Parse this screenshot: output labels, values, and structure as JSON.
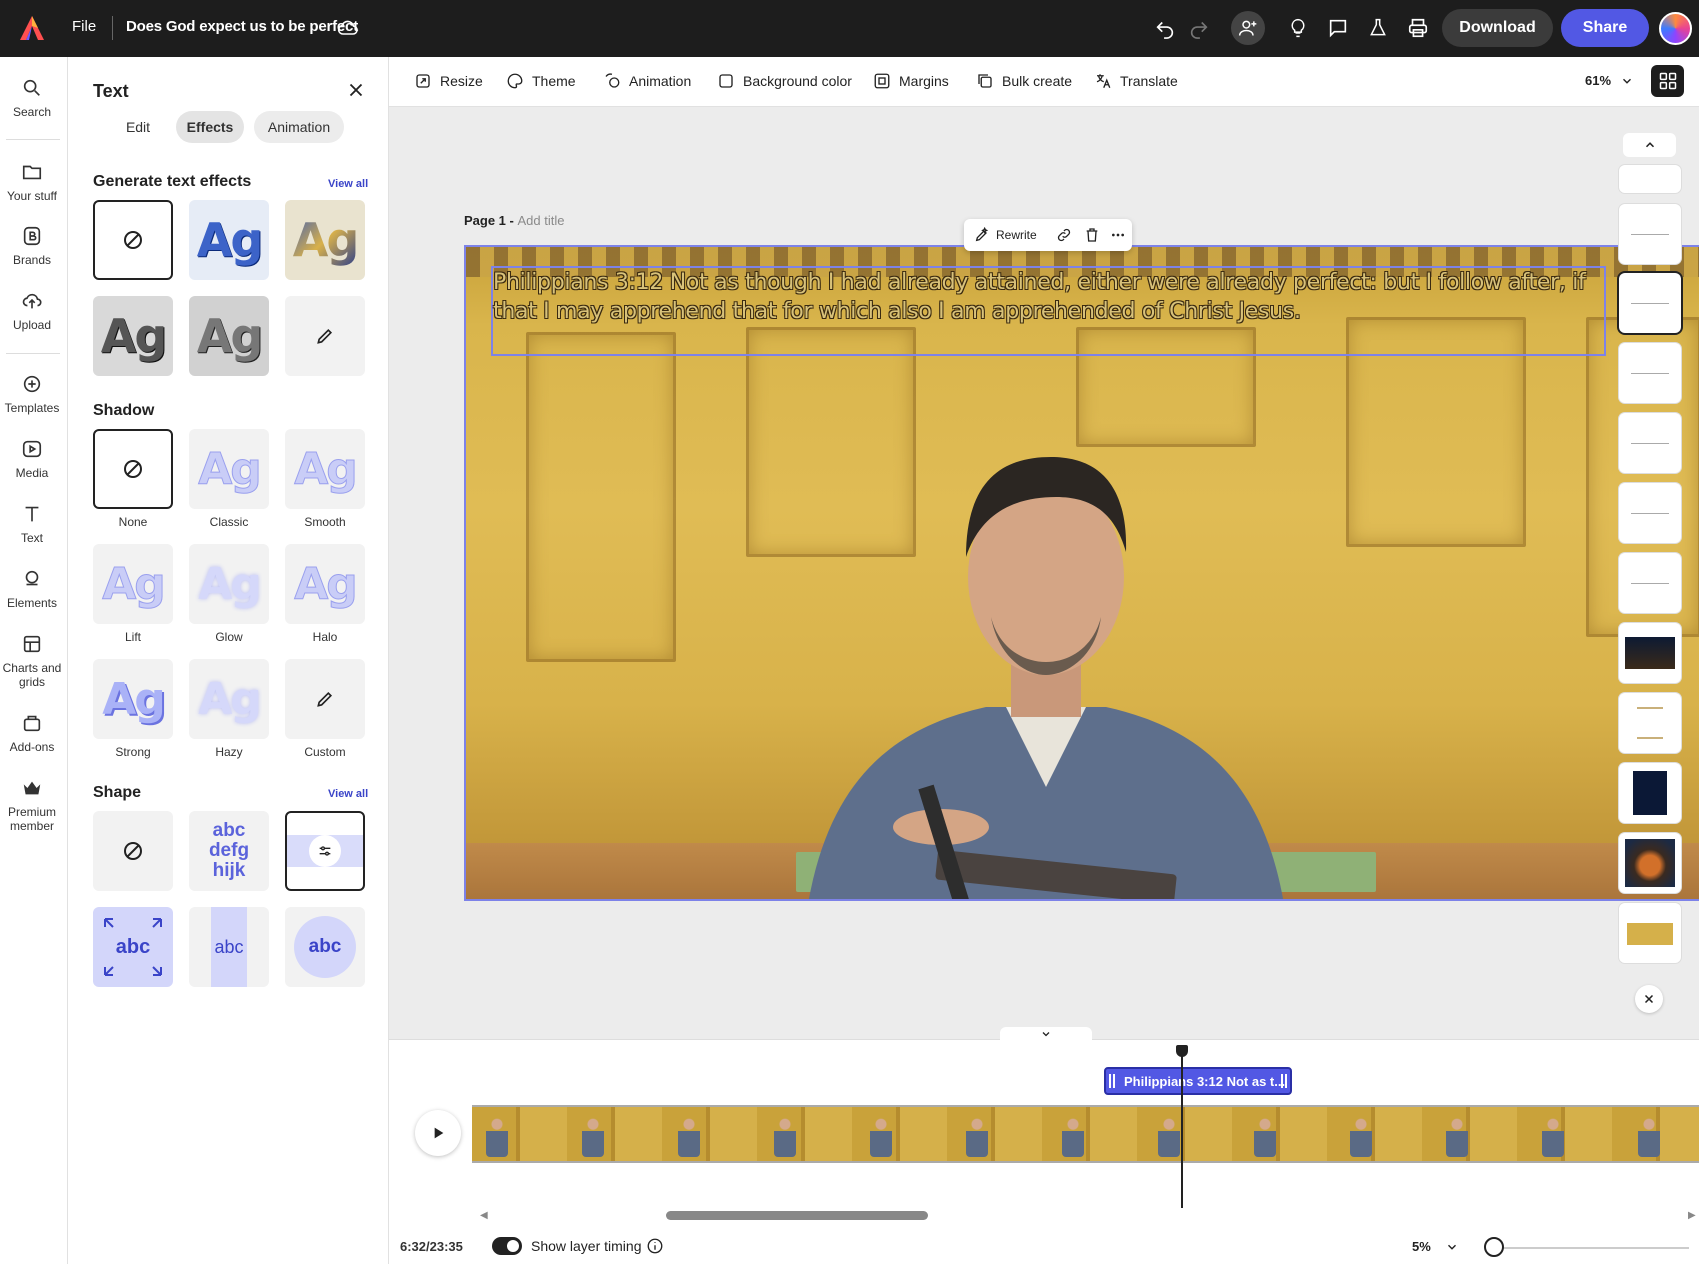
{
  "topbar": {
    "file_label": "File",
    "doc_title": "Does God expect us to be perfect",
    "download_label": "Download",
    "share_label": "Share"
  },
  "rail": {
    "items": [
      {
        "label": "Search",
        "icon": "search-icon"
      },
      {
        "label": "Your stuff",
        "icon": "folder-icon"
      },
      {
        "label": "Brands",
        "icon": "brand-icon"
      },
      {
        "label": "Upload",
        "icon": "upload-icon"
      },
      {
        "label": "Templates",
        "icon": "templates-icon"
      },
      {
        "label": "Media",
        "icon": "media-icon"
      },
      {
        "label": "Text",
        "icon": "text-icon"
      },
      {
        "label": "Elements",
        "icon": "elements-icon"
      },
      {
        "label": "Charts and grids",
        "icon": "charts-icon"
      },
      {
        "label": "Add-ons",
        "icon": "addons-icon"
      },
      {
        "label": "Premium member",
        "icon": "crown-icon"
      }
    ]
  },
  "panel": {
    "title": "Text",
    "tabs": [
      {
        "label": "Edit",
        "active": false
      },
      {
        "label": "Effects",
        "active": true
      },
      {
        "label": "Animation",
        "active": false
      }
    ],
    "generate": {
      "title": "Generate text effects",
      "view_all": "View all",
      "tile_text": "Ag"
    },
    "shadow": {
      "title": "Shadow",
      "options": [
        "None",
        "Classic",
        "Smooth",
        "Lift",
        "Glow",
        "Halo",
        "Strong",
        "Hazy",
        "Custom"
      ]
    },
    "shape": {
      "title": "Shape",
      "view_all": "View all",
      "wrap_lines": [
        "abc",
        "defg",
        "hijk"
      ],
      "abc_text": "abc"
    }
  },
  "context_toolbar": {
    "items": [
      "Resize",
      "Theme",
      "Animation",
      "Background color",
      "Margins",
      "Bulk create",
      "Translate"
    ],
    "zoom": "61%"
  },
  "canvas": {
    "page_label": "Page 1 - ",
    "add_title": "Add title",
    "verse": "Philippians 3:12  Not as though I had already attained, either were already perfect: but I follow after, if that I may apprehend that for which also I am apprehended of Christ Jesus.",
    "float_toolbar": {
      "rewrite": "Rewrite"
    }
  },
  "timeline": {
    "clip_label": "Philippians 3:12 Not as t...",
    "timecode": "6:32/23:35",
    "show_layer_timing": "Show layer timing",
    "zoom": "5%"
  },
  "colors": {
    "accent": "#5258e4",
    "topbar_bg": "#1d1d1d",
    "selection": "#7d82e8"
  }
}
